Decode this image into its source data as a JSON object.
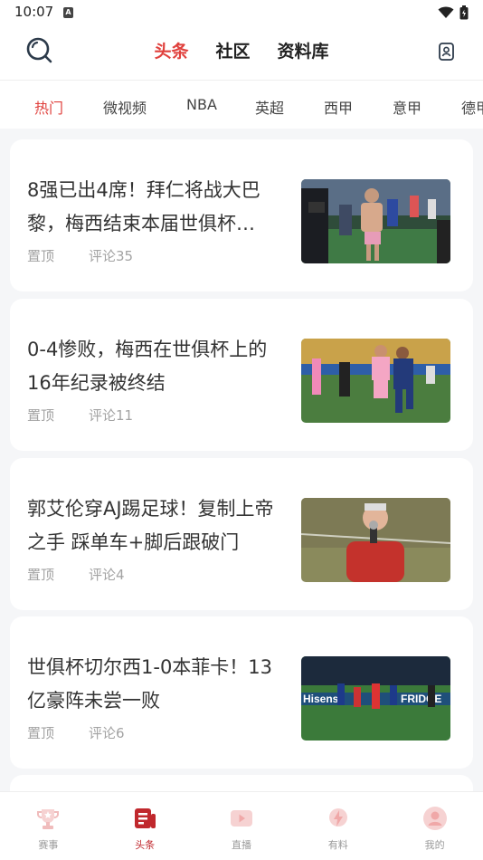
{
  "status_bar": {
    "time": "10:07",
    "a_badge": "A"
  },
  "header": {
    "tabs": [
      {
        "label": "头条",
        "active": true
      },
      {
        "label": "社区",
        "active": false
      },
      {
        "label": "资料库",
        "active": false
      }
    ]
  },
  "categories": [
    "热门",
    "微视频",
    "NBA",
    "英超",
    "西甲",
    "意甲",
    "德甲"
  ],
  "articles": [
    {
      "title": "8强已出4席！拜仁将战大巴黎，梅西结束本届世俱杯…",
      "pin": "置顶",
      "comments": "评论35"
    },
    {
      "title": "0-4惨败，梅西在世俱杯上的16年纪录被终结",
      "pin": "置顶",
      "comments": "评论11"
    },
    {
      "title": "郭艾伦穿AJ踢足球！复制上帝之手 踩单车+脚后跟破门",
      "pin": "置顶",
      "comments": "评论4"
    },
    {
      "title": "世俱杯切尔西1-0本菲卡！13亿豪阵未尝一败",
      "pin": "置顶",
      "comments": "评论6"
    }
  ],
  "thumb4_text": {
    "hisense": "Hisense",
    "fridge": "FRIDGE"
  },
  "tabbar": [
    {
      "label": "赛事",
      "icon": "trophy-icon",
      "active": false
    },
    {
      "label": "头条",
      "icon": "news-icon",
      "active": true
    },
    {
      "label": "直播",
      "icon": "play-icon",
      "active": false
    },
    {
      "label": "有料",
      "icon": "lightning-icon",
      "active": false
    },
    {
      "label": "我的",
      "icon": "user-icon",
      "active": false
    }
  ],
  "colors": {
    "accent": "#e0413d",
    "tab_active": "#c0282d",
    "background": "#f5f6f8"
  }
}
